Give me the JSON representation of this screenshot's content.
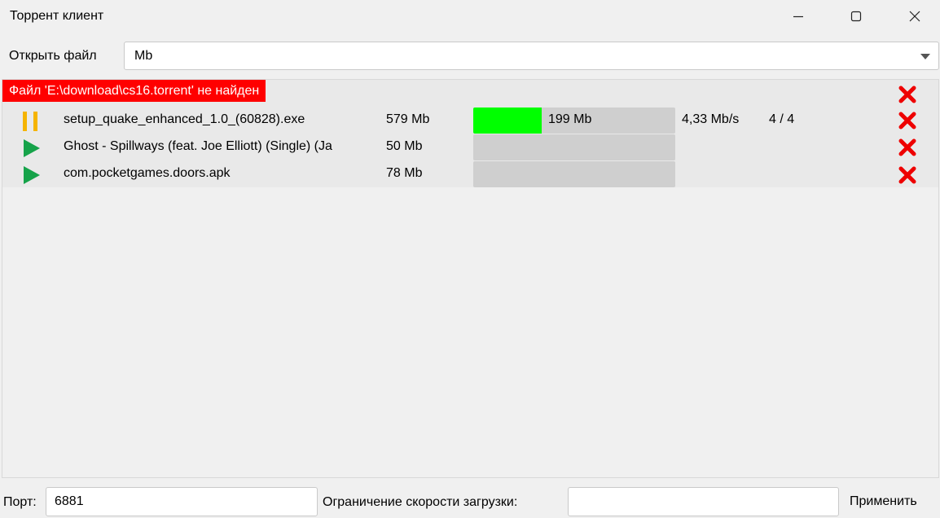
{
  "window": {
    "title": "Торрент клиент"
  },
  "toolbar": {
    "open_file_label": "Открыть файл",
    "unit_select": {
      "value": "Mb"
    }
  },
  "error": {
    "message": "Файл 'E:\\download\\cs16.torrent' не найден"
  },
  "colors": {
    "error_bg": "#ff0000",
    "progress_fill": "#00ff00",
    "progress_track": "#cfcfcf",
    "play_icon": "#16a34a",
    "pause_icon": "#f5b400",
    "delete_icon": "#ee0000"
  },
  "torrents": [
    {
      "state": "paused",
      "state_icon": "pause-icon",
      "name": "setup_quake_enhanced_1.0_(60828).exe",
      "size": "579 Mb",
      "downloaded": "199 Mb",
      "progress_fraction": 0.34,
      "speed": "4,33 Mb/s",
      "peers": "4 / 4"
    },
    {
      "state": "stopped",
      "state_icon": "play-icon",
      "name": "Ghost - Spillways (feat. Joe Elliott) (Single) (Ja",
      "size": "50 Mb",
      "downloaded": "",
      "progress_fraction": 0,
      "speed": "",
      "peers": ""
    },
    {
      "state": "stopped",
      "state_icon": "play-icon",
      "name": "com.pocketgames.doors.apk",
      "size": "78 Mb",
      "downloaded": "",
      "progress_fraction": 0,
      "speed": "",
      "peers": ""
    }
  ],
  "footer": {
    "port_label": "Порт:",
    "port_value": "6881",
    "limit_label": "Ограничение скорости загрузки:",
    "limit_value": "",
    "apply_label": "Применить"
  }
}
